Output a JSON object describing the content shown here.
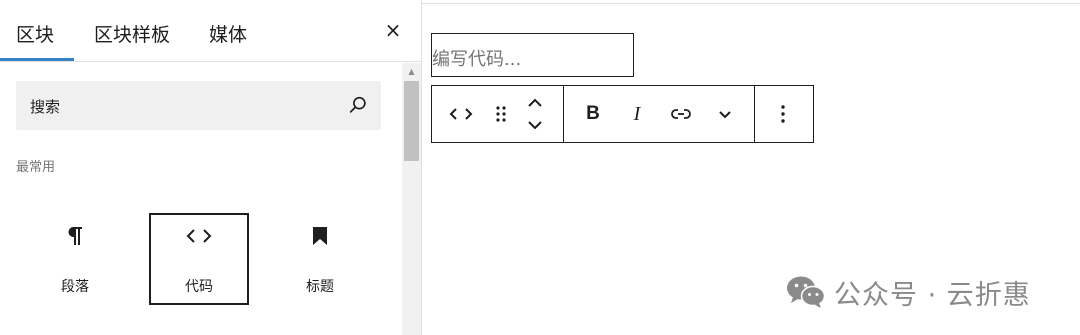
{
  "inserter": {
    "tabs": [
      {
        "label": "区块"
      },
      {
        "label": "区块样板"
      },
      {
        "label": "媒体"
      }
    ],
    "close_label": "×",
    "search": {
      "placeholder": "搜索"
    },
    "section_title": "最常用",
    "blocks": [
      {
        "label": "段落",
        "icon": "paragraph-icon"
      },
      {
        "label": "代码",
        "icon": "code-icon"
      },
      {
        "label": "标题",
        "icon": "bookmark-icon"
      }
    ]
  },
  "editor": {
    "code_placeholder": "编写代码...",
    "toolbar": {
      "buttons": [
        "code-block-icon",
        "drag-handle-icon",
        "move-up-down-icon",
        "bold",
        "italic",
        "link-icon",
        "chevron-down-icon",
        "more-options-icon"
      ],
      "bold_label": "B",
      "italic_label": "I"
    }
  },
  "watermark": {
    "text": "公众号 · 云折惠",
    "icon": "wechat-icon"
  },
  "colors": {
    "accent": "#3582c4",
    "text": "#1e1e1e",
    "muted": "#757575",
    "search_bg": "#f0f0f0"
  }
}
